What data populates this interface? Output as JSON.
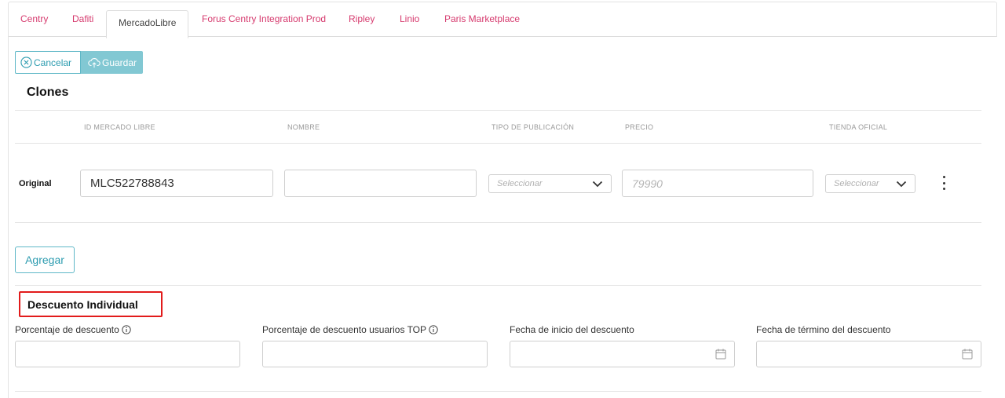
{
  "tabs": [
    {
      "label": "Centry",
      "active": false
    },
    {
      "label": "Dafiti",
      "active": false
    },
    {
      "label": "MercadoLibre",
      "active": true
    },
    {
      "label": "Forus Centry Integration Prod",
      "active": false
    },
    {
      "label": "Ripley",
      "active": false
    },
    {
      "label": "Linio",
      "active": false
    },
    {
      "label": "Paris Marketplace",
      "active": false
    }
  ],
  "toolbar": {
    "cancel_label": "Cancelar",
    "save_label": "Guardar"
  },
  "clones": {
    "title": "Clones",
    "columns": [
      "ID MERCADO LIBRE",
      "NOMBRE",
      "TIPO DE PUBLICACIÓN",
      "PRECIO",
      "TIENDA OFICIAL"
    ],
    "row": {
      "label": "Original",
      "id_value": "MLC522788843",
      "name_value": "",
      "publication_placeholder": "Seleccionar",
      "price_placeholder": "79990",
      "store_placeholder": "Seleccionar"
    },
    "add_label": "Agregar"
  },
  "discount": {
    "title": "Descuento Individual",
    "fields": [
      {
        "label": "Porcentaje de descuento",
        "info": true
      },
      {
        "label": "Porcentaje de descuento usuarios TOP",
        "info": true
      },
      {
        "label": "Fecha de inicio del descuento",
        "info": false
      },
      {
        "label": "Fecha de término del descuento",
        "info": false
      }
    ]
  },
  "colors": {
    "accent": "#2d9cb0",
    "tab_link": "#d63a6e",
    "highlight": "#e21b1b"
  }
}
